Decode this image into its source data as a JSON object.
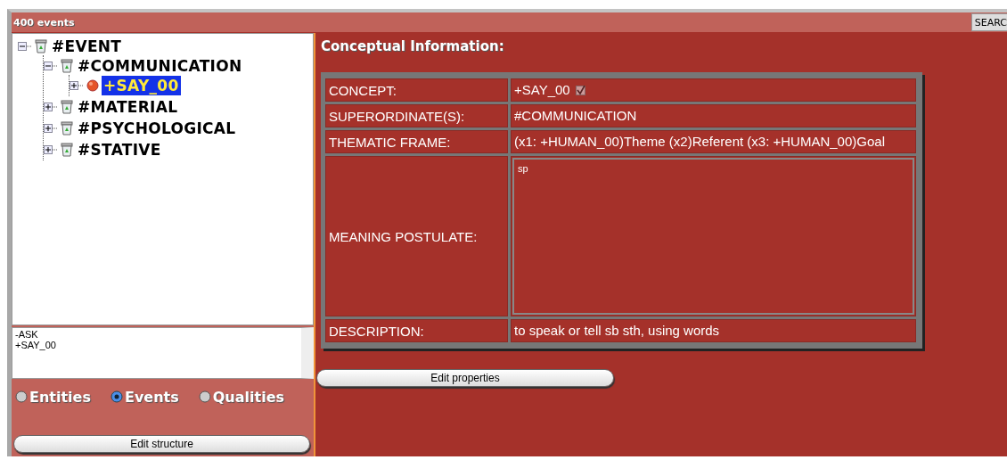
{
  "header": {
    "title": "400 events",
    "search_button": "SEARC"
  },
  "tree": [
    {
      "label": "#EVENT",
      "kind": "category",
      "expanded": true,
      "selected": false,
      "children": [
        {
          "label": "#COMMUNICATION",
          "kind": "category",
          "expanded": true,
          "selected": false,
          "children": [
            {
              "label": "+SAY_00",
              "kind": "concept",
              "expanded": false,
              "selected": true
            }
          ]
        },
        {
          "label": "#MATERIAL",
          "kind": "category",
          "expanded": false,
          "selected": false
        },
        {
          "label": "#PSYCHOLOGICAL",
          "kind": "category",
          "expanded": false,
          "selected": false
        },
        {
          "label": "#STATIVE",
          "kind": "category",
          "expanded": false,
          "selected": false
        }
      ]
    }
  ],
  "word_list": [
    "-ASK",
    "+SAY_00"
  ],
  "radios": [
    {
      "label": "Entities",
      "selected": false
    },
    {
      "label": "Events",
      "selected": true
    },
    {
      "label": "Qualities",
      "selected": false
    }
  ],
  "edit_structure_button": "Edit structure",
  "section_title": "Conceptual Information:",
  "rows": [
    {
      "label": "CONCEPT:",
      "kind": "text",
      "value": "+SAY_00",
      "checked": true
    },
    {
      "label": "SUPERORDINATE(S):",
      "kind": "text",
      "value": "#COMMUNICATION"
    },
    {
      "label": "THEMATIC FRAME:",
      "kind": "text",
      "value": "(x1: +HUMAN_00)Theme (x2)Referent (x3: +HUMAN_00)Goal"
    },
    {
      "label": "MEANING POSTULATE:",
      "kind": "textarea",
      "value": "sp"
    },
    {
      "label": "DESCRIPTION:",
      "kind": "text",
      "value": "to speak or tell sb sth, using words"
    }
  ],
  "edit_properties_button": "Edit properties"
}
